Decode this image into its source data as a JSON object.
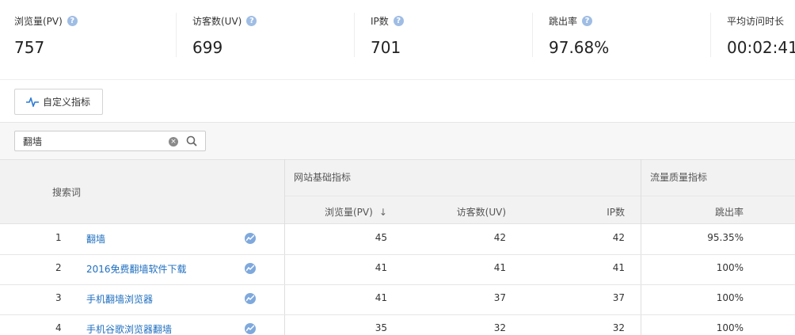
{
  "metrics": [
    {
      "label": "浏览量(PV)",
      "value": "757",
      "help": "?"
    },
    {
      "label": "访客数(UV)",
      "value": "699",
      "help": "?"
    },
    {
      "label": "IP数",
      "value": "701",
      "help": "?"
    },
    {
      "label": "跳出率",
      "value": "97.68%",
      "help": "?"
    },
    {
      "label": "平均访问时长",
      "value": "00:02:41",
      "help": ""
    }
  ],
  "toolbar": {
    "custom_metrics_label": "自定义指标"
  },
  "search": {
    "value": "翻墙",
    "clear_glyph": "×"
  },
  "table": {
    "group_headers": {
      "keyword": "搜索词",
      "basic": "网站基础指标",
      "quality": "流量质量指标"
    },
    "columns": {
      "pv": "浏览量(PV)",
      "pv_sort": "↓",
      "uv": "访客数(UV)",
      "ip": "IP数",
      "bounce": "跳出率"
    },
    "rows": [
      {
        "index": "1",
        "keyword": "翻墙",
        "pv": "45",
        "uv": "42",
        "ip": "42",
        "bounce": "95.35%"
      },
      {
        "index": "2",
        "keyword": "2016免费翻墙软件下载",
        "pv": "41",
        "uv": "41",
        "ip": "41",
        "bounce": "100%"
      },
      {
        "index": "3",
        "keyword": "手机翻墙浏览器",
        "pv": "41",
        "uv": "37",
        "ip": "37",
        "bounce": "100%"
      },
      {
        "index": "4",
        "keyword": "手机谷歌浏览器翻墙",
        "pv": "35",
        "uv": "32",
        "ip": "32",
        "bounce": "100%"
      }
    ]
  },
  "icons": {
    "help": "question-icon",
    "custom": "pulse-icon",
    "clear": "clear-icon",
    "search": "search-icon",
    "trend": "trend-icon"
  },
  "colors": {
    "link": "#1f6fbf",
    "help_badge": "#9fbde4",
    "trend_badge": "#7fa9dd",
    "header_bg": "#f2f2f2"
  }
}
